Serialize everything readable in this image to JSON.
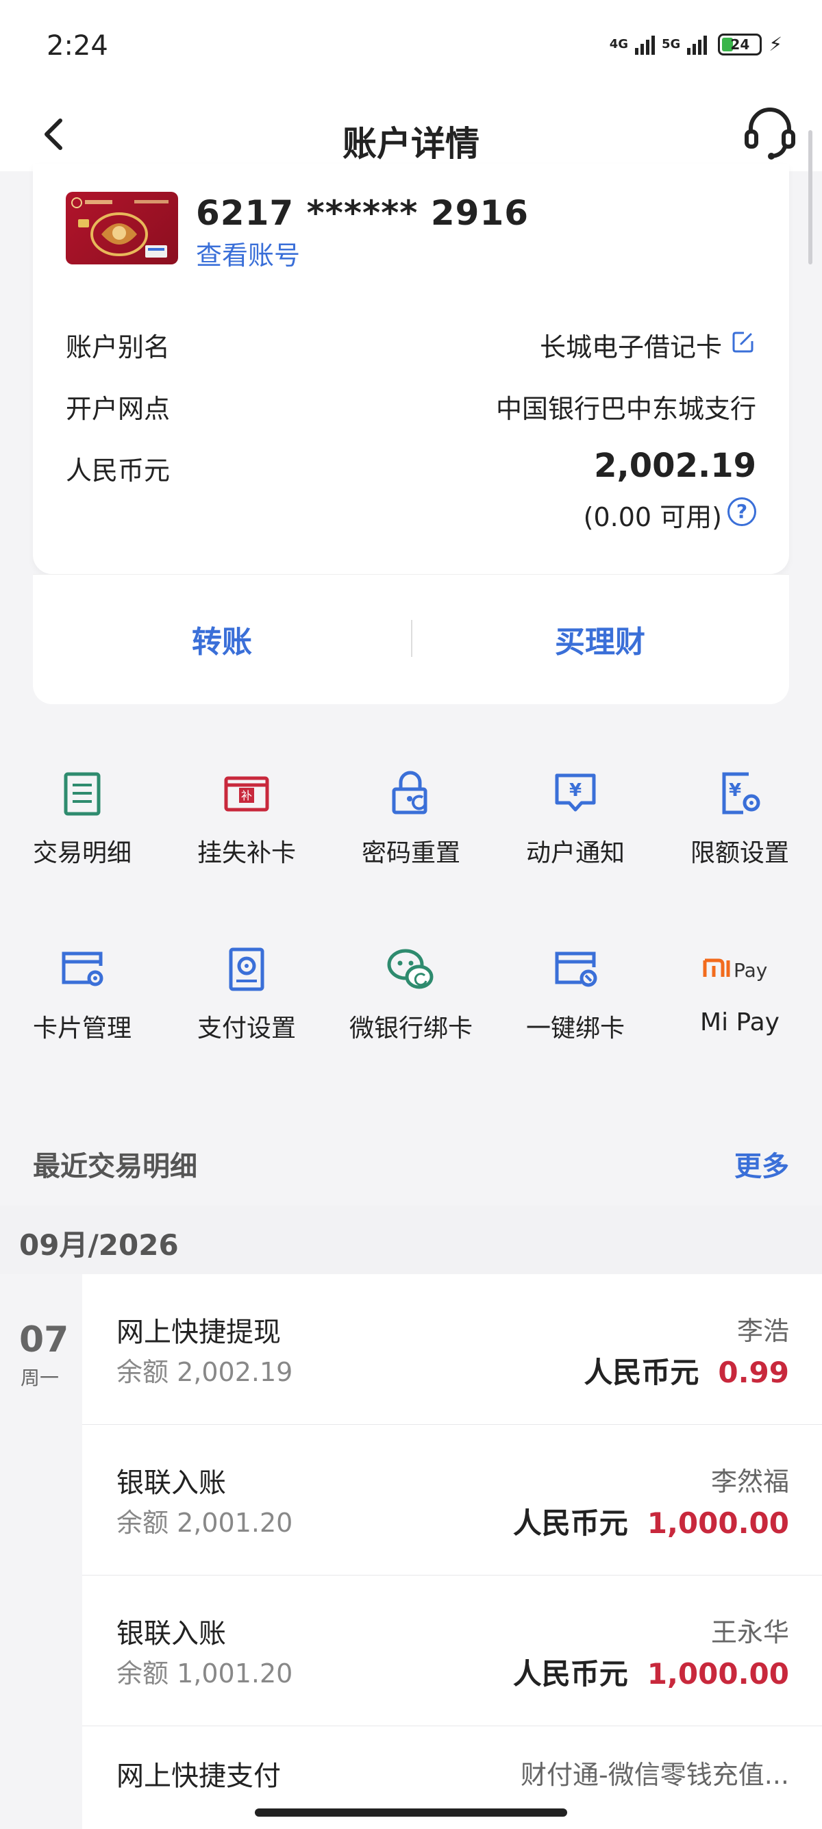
{
  "status": {
    "time": "2:24",
    "net1": "4G",
    "net2": "5G",
    "battery": "24"
  },
  "header": {
    "title": "账户详情"
  },
  "account": {
    "card_number": "6217 ****** 2916",
    "view_account": "查看账号",
    "alias_label": "账户别名",
    "alias_value": "长城电子借记卡",
    "branch_label": "开户网点",
    "branch_value": "中国银行巴中东城支行",
    "currency_label": "人民币元",
    "balance": "2,002.19",
    "available": "(0.00 可用)"
  },
  "actions": {
    "transfer": "转账",
    "buy": "买理财"
  },
  "functions": [
    {
      "label": "交易明细",
      "icon": "list-icon"
    },
    {
      "label": "挂失补卡",
      "icon": "report-loss-icon",
      "icon_text": "补"
    },
    {
      "label": "密码重置",
      "icon": "lock-reset-icon"
    },
    {
      "label": "动户通知",
      "icon": "notification-yen-icon"
    },
    {
      "label": "限额设置",
      "icon": "limit-settings-icon"
    },
    {
      "label": "卡片管理",
      "icon": "card-settings-icon"
    },
    {
      "label": "支付设置",
      "icon": "payment-settings-icon"
    },
    {
      "label": "微银行绑卡",
      "icon": "wechat-icon"
    },
    {
      "label": "一键绑卡",
      "icon": "card-bind-icon"
    },
    {
      "label": "Mi Pay",
      "icon": "mi-pay-icon",
      "icon_text": "Pay"
    }
  ],
  "recent": {
    "title": "最近交易明细",
    "more": "更多",
    "month": "09月/2026",
    "day": "07",
    "weekday": "周一",
    "transactions": [
      {
        "name": "网上快捷提现",
        "balance": "余额  2,002.19",
        "party": "李浩",
        "currency": "人民币元",
        "amount": "0.99"
      },
      {
        "name": "银联入账",
        "balance": "余额  2,001.20",
        "party": "李然福",
        "currency": "人民币元",
        "amount": "1,000.00"
      },
      {
        "name": "银联入账",
        "balance": "余额  1,001.20",
        "party": "王永华",
        "currency": "人民币元",
        "amount": "1,000.00"
      },
      {
        "name": "网上快捷支付",
        "party": "财付通-微信零钱充值..."
      }
    ]
  },
  "colors": {
    "accent": "#3a6fd8",
    "green": "#2e8b6e",
    "red": "#c8283c",
    "orange": "#f26b1d"
  }
}
